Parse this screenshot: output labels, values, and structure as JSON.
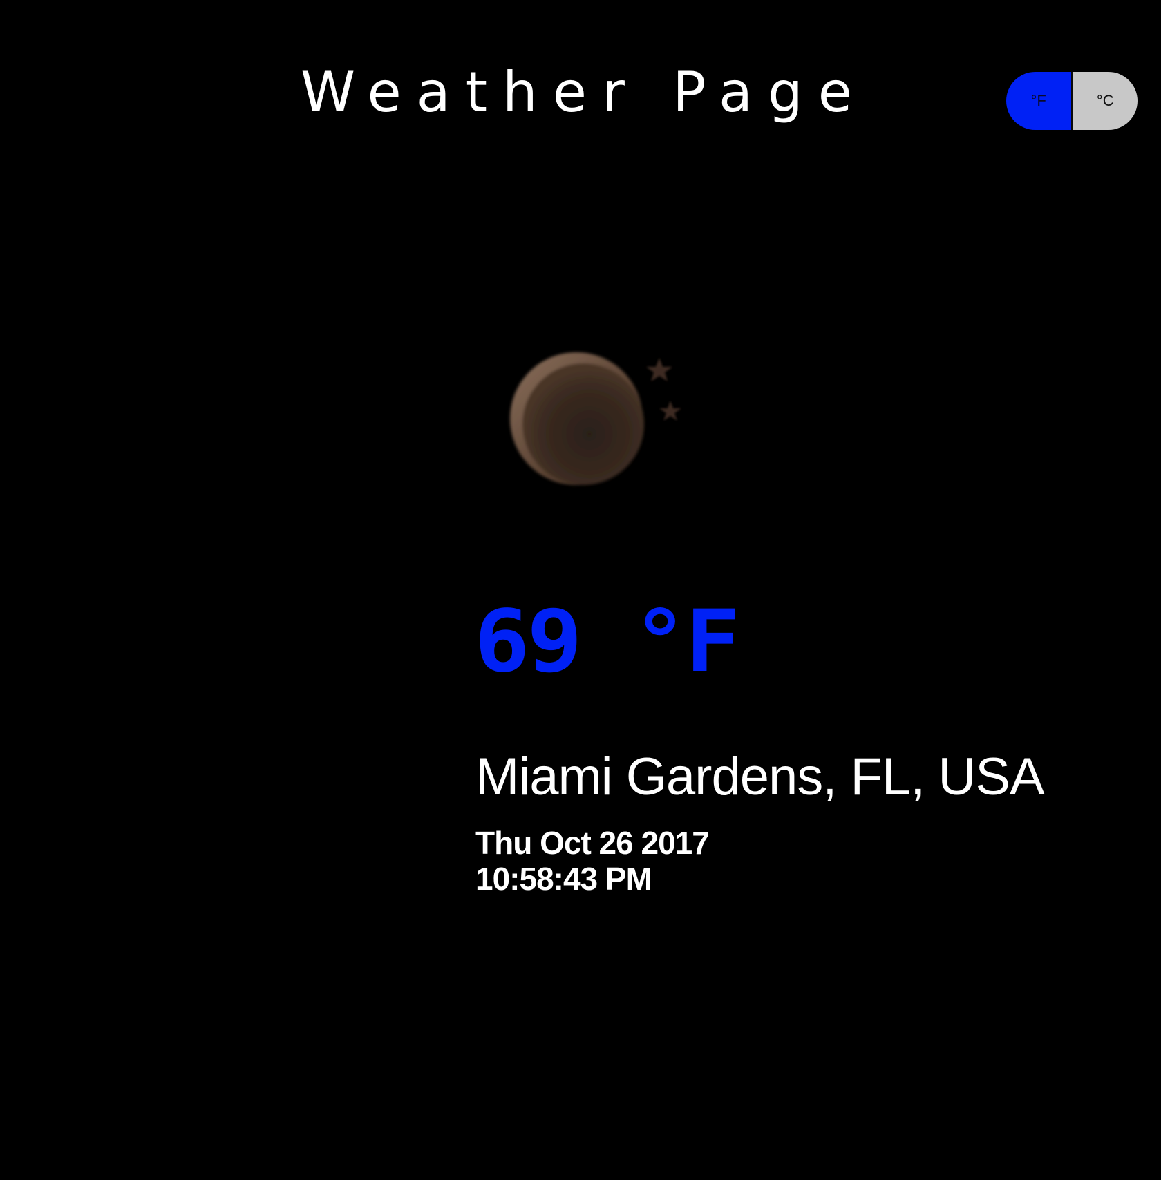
{
  "header": {
    "title": "Weather Page"
  },
  "unit_toggle": {
    "fahrenheit_label": "°F",
    "celsius_label": "°C",
    "selected": "°F",
    "active_color": "#0021f5",
    "inactive_color": "#c8c8c8"
  },
  "weather": {
    "icon": "night-moon-stars-icon",
    "temperature": "69 °F",
    "location": "Miami Gardens, FL, USA",
    "date": "Thu Oct 26 2017",
    "time": "10:58:43 PM",
    "temperature_color": "#0021f5"
  }
}
